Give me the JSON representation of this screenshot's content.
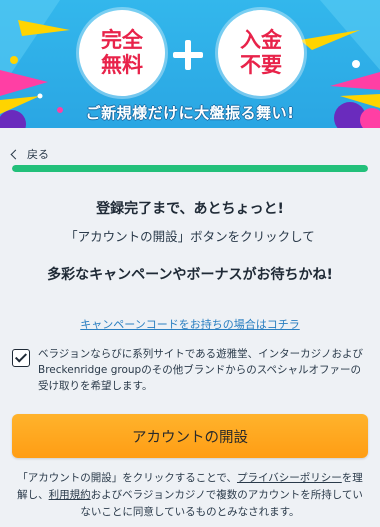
{
  "banner": {
    "badge_left": "完全\n無料",
    "badge_right": "入金\n不要",
    "tagline": "ご新規様だけに大盤振る舞い!"
  },
  "nav": {
    "back_label": "戻る"
  },
  "progress": {
    "fraction": 1.0,
    "color": "#22c07a"
  },
  "content": {
    "heading": "登録完了まで、あとちょっと!",
    "subtext": "「アカウントの開設」ボタンをクリックして",
    "promo_heading": "多彩なキャンペーンやボーナスがお待ちかね!",
    "promo_code_link": "キャンペーンコードをお持ちの場合はコチラ"
  },
  "consent": {
    "checked": true,
    "text": "ベラジョンならびに系列サイトである遊雅堂、インターカジノおよびBreckenridge groupのその他ブランドからのスペシャルオファーの受け取りを希望します。"
  },
  "cta": {
    "label": "アカウントの開設",
    "color": "#ffa51f"
  },
  "footer": {
    "part1": "「アカウントの開設」をクリックすることで、",
    "privacy_link": "プライバシーポリシー",
    "part2": "を理解し、",
    "terms_link": "利用規約",
    "part3": "およびベラジョンカジノで複数のアカウントを所持していないことに同意しているものとみなされます。"
  }
}
